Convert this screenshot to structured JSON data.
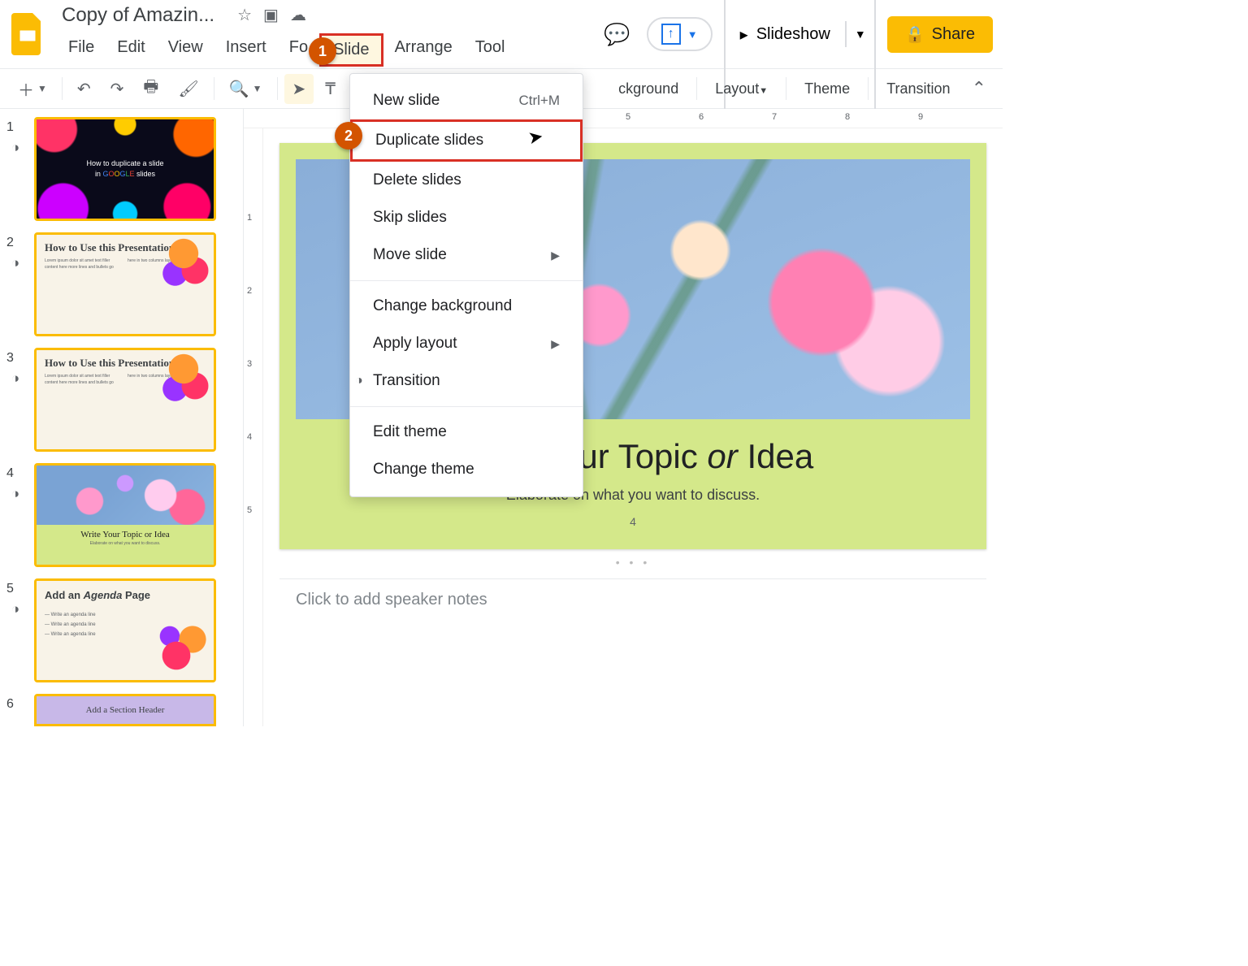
{
  "app": {
    "title": "Copy of Amazin..."
  },
  "menubar": {
    "file": "File",
    "edit": "Edit",
    "view": "View",
    "insert": "Insert",
    "format": "Fo",
    "slide": "Slide",
    "arrange": "Arrange",
    "tools": "Tool"
  },
  "actions": {
    "slideshow": "Slideshow",
    "share": "Share"
  },
  "toolbar": {
    "background": "ckground",
    "layout": "Layout",
    "theme": "Theme",
    "transition": "Transition"
  },
  "dropdown": {
    "new_slide": "New slide",
    "new_slide_sc": "Ctrl+M",
    "duplicate": "Duplicate slides",
    "delete": "Delete slides",
    "skip": "Skip slides",
    "move": "Move slide",
    "change_bg": "Change background",
    "apply_layout": "Apply layout",
    "transition": "Transition",
    "edit_theme": "Edit theme",
    "change_theme": "Change theme"
  },
  "thumbs": {
    "n1": "1",
    "n2": "2",
    "n3": "3",
    "n4": "4",
    "n5": "5",
    "n6": "6",
    "t1_l1": "How to duplicate a slide",
    "t1_l2": "in GOOGLE slides",
    "t23_title": "How to Use this Presentation",
    "t4_cap": "Write Your Topic or Idea",
    "t4_sub": "Elaborate on what you want to discuss.",
    "t5_title_a": "Add an ",
    "t5_title_i": "Agenda",
    "t5_title_b": " Page",
    "t5_line": "— Write an agenda line",
    "t6_title": "Add a Section Header"
  },
  "canvas": {
    "title_a": "Write Your Topic ",
    "title_i": "or",
    "title_b": " Idea",
    "sub": "Elaborate on what you want to discuss.",
    "page": "4"
  },
  "notes": {
    "placeholder": "Click to add speaker notes"
  },
  "ruler_h": [
    "5",
    "6",
    "7",
    "8",
    "9"
  ],
  "ruler_v": [
    "1",
    "2",
    "3",
    "4",
    "5"
  ],
  "badges": {
    "b1": "1",
    "b2": "2"
  }
}
